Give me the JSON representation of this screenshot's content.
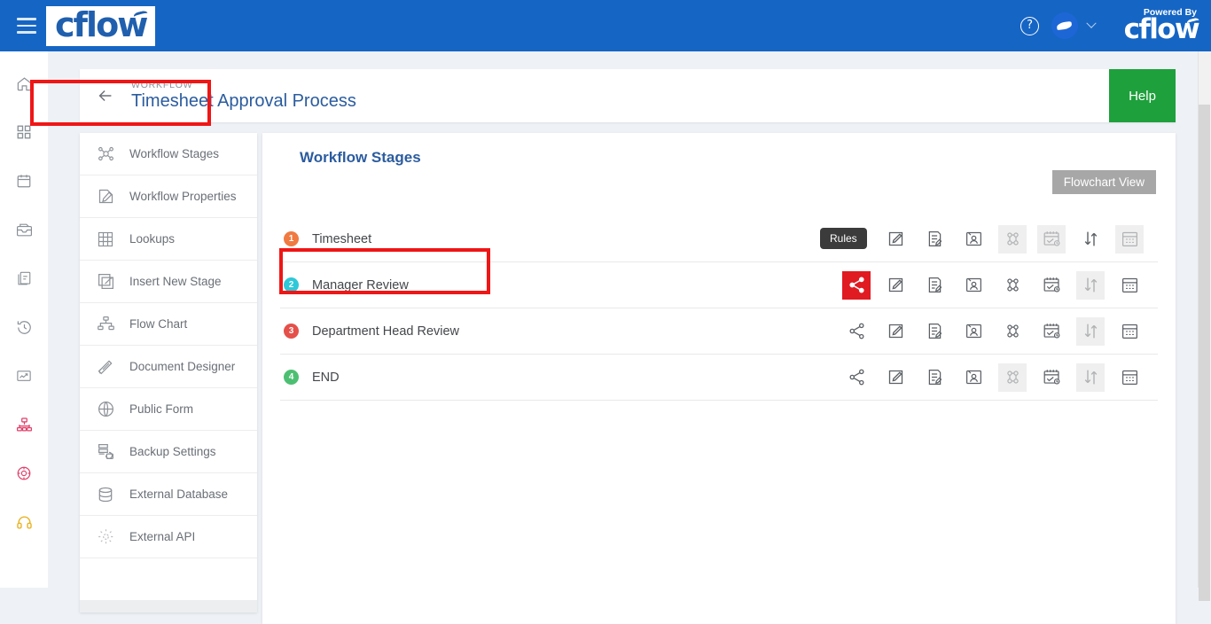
{
  "topbar": {
    "menu_icon": "hamburger-icon",
    "brand": "cflow",
    "help_icon": "question-circle-icon",
    "avatar_icon": "user-avatar",
    "caret_icon": "chevron-down-icon",
    "powered_by_label": "Powered By",
    "powered_by_brand": "cflow",
    "bg_color": "#1565c4"
  },
  "rail": {
    "items": [
      {
        "name": "home-icon",
        "label": "Home",
        "color": "#8a9097"
      },
      {
        "name": "apps-grid-icon",
        "label": "Apps",
        "color": "#8a9097"
      },
      {
        "name": "calendar-icon",
        "label": "Calendar",
        "color": "#8a9097"
      },
      {
        "name": "inbox-icon",
        "label": "Inbox",
        "color": "#8a9097"
      },
      {
        "name": "documents-icon",
        "label": "Documents",
        "color": "#8a9097"
      },
      {
        "name": "history-clock-icon",
        "label": "History",
        "color": "#8a9097"
      },
      {
        "name": "reports-icon",
        "label": "Reports",
        "color": "#8a9097"
      },
      {
        "name": "workflow-icon",
        "label": "Workflow",
        "color": "#e0416a"
      },
      {
        "name": "settings-target-icon",
        "label": "Settings",
        "color": "#e0416a"
      },
      {
        "name": "support-headset-icon",
        "label": "Support",
        "color": "#e8b426"
      }
    ]
  },
  "page_header": {
    "back_icon": "arrow-left-icon",
    "kicker": "WORKFLOW",
    "title": "Timesheet Approval Process",
    "help_label": "Help",
    "help_color": "#1ea03c"
  },
  "menu": {
    "items": [
      {
        "label": "Workflow Stages",
        "icon": "workflow-stages-icon",
        "selected": true
      },
      {
        "label": "Workflow Properties",
        "icon": "edit-properties-icon",
        "selected": false
      },
      {
        "label": "Lookups",
        "icon": "grid-table-icon",
        "selected": false
      },
      {
        "label": "Insert New Stage",
        "icon": "insert-stage-icon",
        "selected": false
      },
      {
        "label": "Flow Chart",
        "icon": "flow-chart-icon",
        "selected": false
      },
      {
        "label": "Document Designer",
        "icon": "document-designer-icon",
        "selected": false
      },
      {
        "label": "Public Form",
        "icon": "globe-icon",
        "selected": false
      },
      {
        "label": "Backup Settings",
        "icon": "backup-settings-icon",
        "selected": false
      },
      {
        "label": "External Database",
        "icon": "database-icon",
        "selected": false
      },
      {
        "label": "External API",
        "icon": "gear-api-icon",
        "selected": false
      }
    ]
  },
  "content": {
    "title": "Workflow Stages",
    "flowchart_view_label": "Flowchart View",
    "tooltip_label": "Rules",
    "action_icons": [
      {
        "name": "rules-share-icon",
        "label": "Rules"
      },
      {
        "name": "edit-stage-icon",
        "label": "Edit Stage"
      },
      {
        "name": "form-fields-icon",
        "label": "Form Fields"
      },
      {
        "name": "assign-user-icon",
        "label": "Assign User"
      },
      {
        "name": "parallel-flow-icon",
        "label": "Parallel Flow"
      },
      {
        "name": "schedule-icon",
        "label": "Schedule"
      },
      {
        "name": "reorder-arrows-icon",
        "label": "Reorder"
      },
      {
        "name": "calendar-grid-icon",
        "label": "Calendar"
      }
    ],
    "stages": [
      {
        "number": "1",
        "name": "Timesheet",
        "badge_color": "#f07a41",
        "highlighted": false,
        "actions": [
          {
            "state": "normal"
          },
          {
            "state": "normal"
          },
          {
            "state": "normal"
          },
          {
            "state": "normal"
          },
          {
            "state": "disabled"
          },
          {
            "state": "disabled"
          },
          {
            "state": "normal"
          },
          {
            "state": "disabled"
          }
        ]
      },
      {
        "number": "2",
        "name": "Manager Review",
        "badge_color": "#2ec8d8",
        "highlighted": true,
        "actions": [
          {
            "state": "active"
          },
          {
            "state": "normal"
          },
          {
            "state": "normal"
          },
          {
            "state": "normal"
          },
          {
            "state": "normal"
          },
          {
            "state": "normal"
          },
          {
            "state": "disabled"
          },
          {
            "state": "normal"
          }
        ]
      },
      {
        "number": "3",
        "name": "Department Head Review",
        "badge_color": "#e5504a",
        "highlighted": false,
        "actions": [
          {
            "state": "normal"
          },
          {
            "state": "normal"
          },
          {
            "state": "normal"
          },
          {
            "state": "normal"
          },
          {
            "state": "normal"
          },
          {
            "state": "normal"
          },
          {
            "state": "disabled"
          },
          {
            "state": "normal"
          }
        ]
      },
      {
        "number": "4",
        "name": "END",
        "badge_color": "#4dbf72",
        "highlighted": false,
        "actions": [
          {
            "state": "normal"
          },
          {
            "state": "normal"
          },
          {
            "state": "normal"
          },
          {
            "state": "normal"
          },
          {
            "state": "disabled"
          },
          {
            "state": "normal"
          },
          {
            "state": "disabled"
          },
          {
            "state": "normal"
          }
        ]
      }
    ]
  },
  "highlight_color": "#ef1616"
}
